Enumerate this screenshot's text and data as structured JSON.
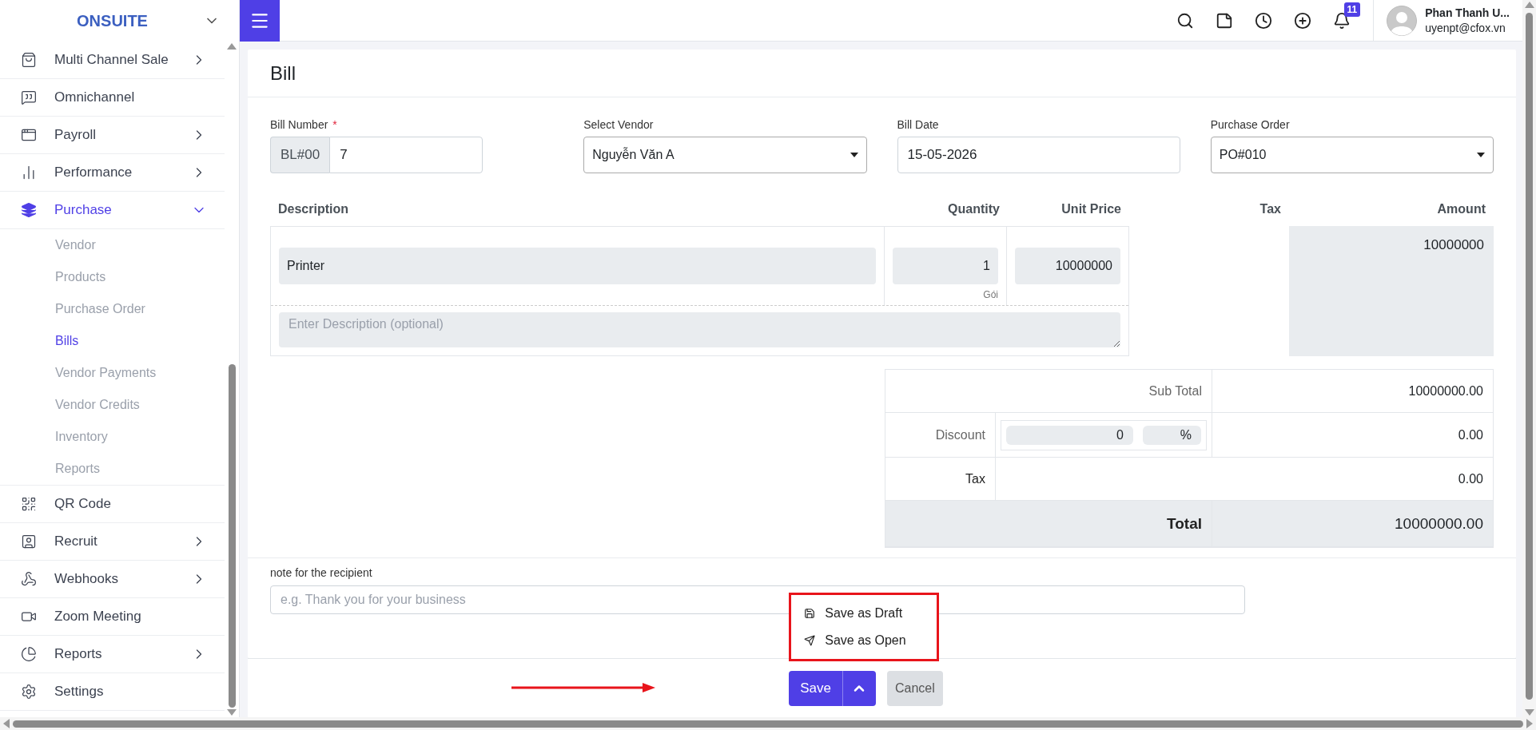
{
  "sidebar": {
    "brand": "ONSUITE",
    "items": [
      {
        "label": "Multi Channel Sale",
        "selected": false,
        "expanded": false
      },
      {
        "label": "Omnichannel",
        "selected": false
      },
      {
        "label": "Payroll",
        "selected": false,
        "expanded": false
      },
      {
        "label": "Performance",
        "selected": false,
        "expanded": false
      },
      {
        "label": "Purchase",
        "selected": true,
        "expanded": true,
        "children": [
          {
            "label": "Vendor",
            "selected": false
          },
          {
            "label": "Products",
            "selected": false
          },
          {
            "label": "Purchase Order",
            "selected": false
          },
          {
            "label": "Bills",
            "selected": true
          },
          {
            "label": "Vendor Payments",
            "selected": false
          },
          {
            "label": "Vendor Credits",
            "selected": false
          },
          {
            "label": "Inventory",
            "selected": false
          },
          {
            "label": "Reports",
            "selected": false
          }
        ]
      },
      {
        "label": "QR Code",
        "selected": false
      },
      {
        "label": "Recruit",
        "selected": false,
        "expanded": false
      },
      {
        "label": "Webhooks",
        "selected": false,
        "expanded": false
      },
      {
        "label": "Zoom Meeting",
        "selected": false
      },
      {
        "label": "Reports",
        "selected": false,
        "expanded": false
      },
      {
        "label": "Settings",
        "selected": false
      }
    ]
  },
  "topbar": {
    "notification_count": "11",
    "user": {
      "name": "Phan Thanh U...",
      "email": "uyenpt@cfox.vn"
    }
  },
  "page": {
    "title": "Bill"
  },
  "fields": [
    {
      "kind": "prefixed",
      "label": "Bill Number",
      "required_mark": "*",
      "prefix": "BL#00",
      "value": "7"
    },
    {
      "kind": "select",
      "label": "Select Vendor",
      "value": "Nguyễn Văn A"
    },
    {
      "kind": "text",
      "label": "Bill Date",
      "value": "15-05-2026"
    },
    {
      "kind": "select",
      "label": "Purchase Order",
      "value": "PO#010"
    }
  ],
  "items_table": {
    "columns": [
      "Description",
      "Quantity",
      "Unit Price",
      "Tax",
      "Amount"
    ],
    "rows": [
      {
        "description": "Printer",
        "quantity": "1",
        "unit": "Gói",
        "unit_price": "10000000",
        "amount": "10000000",
        "note_placeholder": "Enter Description (optional)"
      }
    ]
  },
  "totals": {
    "sub_total": {
      "label": "Sub Total",
      "value": "10000000.00"
    },
    "discount": {
      "label": "Discount",
      "amount": "0",
      "unit": "%",
      "value": "0.00"
    },
    "tax": {
      "label": "Tax",
      "value": "0.00"
    },
    "total": {
      "label": "Total",
      "value": "10000000.00"
    }
  },
  "note": {
    "label": "note for the recipient",
    "placeholder": "e.g. Thank you for your business"
  },
  "actions": {
    "save": "Save",
    "cancel": "Cancel",
    "menu_open": true,
    "menu": [
      "Save as Draft",
      "Save as Open"
    ]
  }
}
